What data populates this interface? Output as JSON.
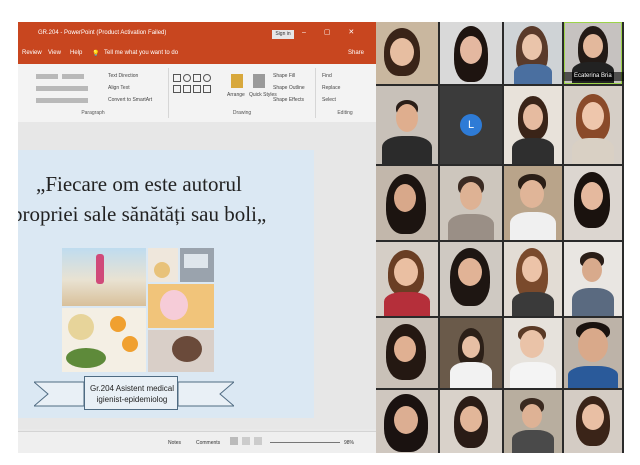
{
  "window": {
    "title": "GR.204 - PowerPoint (Product Activation Failed)",
    "sign_in": "Sign in",
    "controls": "–  ▢  ✕"
  },
  "menu": {
    "items": [
      "Review",
      "View",
      "Help"
    ],
    "tell_me": "Tell me what you want to do",
    "share": "Share"
  },
  "ribbon": {
    "paragraph_label": "Paragraph",
    "drawing_label": "Drawing",
    "editing_label": "Editing",
    "text_direction": "Text Direction",
    "align_text": "Align Text",
    "convert_smartart": "Convert to SmartArt",
    "arrange": "Arrange",
    "quick_styles": "Quick Styles",
    "shape_fill": "Shape Fill",
    "shape_outline": "Shape Outline",
    "shape_effects": "Shape Effects",
    "find": "Find",
    "replace": "Replace",
    "select": "Select"
  },
  "slide": {
    "quote_line1": "„Fiecare om este autorul",
    "quote_line2": "propriei sale sănătăți sau boli„",
    "banner_line1": "Gr.204 Asistent medical",
    "banner_line2": "igienist-epidemiolog"
  },
  "status": {
    "notes": "Notes",
    "comments": "Comments",
    "zoom": "98%"
  },
  "video": {
    "avatar_letter": "L",
    "highlighted_name": "Ecaterina Bria"
  }
}
